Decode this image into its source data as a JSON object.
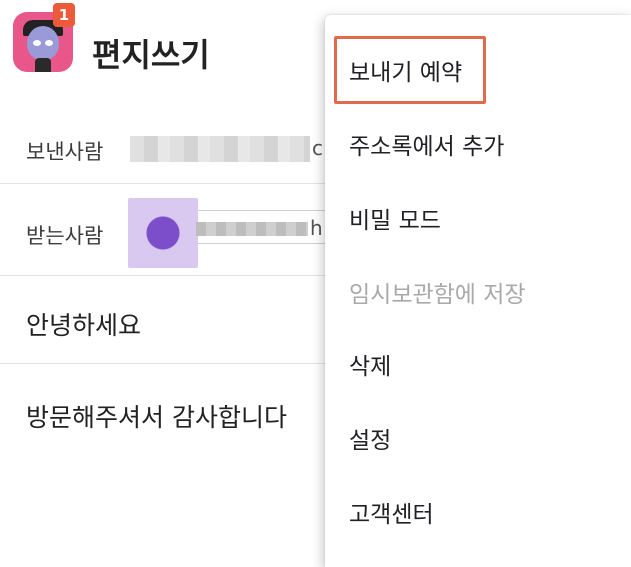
{
  "header": {
    "title": "편지쓰기",
    "badge_count": "1"
  },
  "form": {
    "sender_label": "보낸사람",
    "sender_tail": "c",
    "recipient_label": "받는사람",
    "recipient_tail": "h",
    "subject": "안녕하세요",
    "body": "방문해주셔서 감사합니다"
  },
  "menu": {
    "items": [
      {
        "label": "보내기 예약",
        "state": "highlighted"
      },
      {
        "label": "주소록에서 추가",
        "state": "enabled"
      },
      {
        "label": "비밀 모드",
        "state": "enabled"
      },
      {
        "label": "임시보관함에 저장",
        "state": "disabled"
      },
      {
        "label": "삭제",
        "state": "enabled"
      },
      {
        "label": "설정",
        "state": "enabled"
      },
      {
        "label": "고객센터",
        "state": "enabled"
      }
    ]
  },
  "colors": {
    "badge": "#ec5a3a",
    "highlight_border": "#e06a4d",
    "disabled_text": "#a9a9a9"
  }
}
